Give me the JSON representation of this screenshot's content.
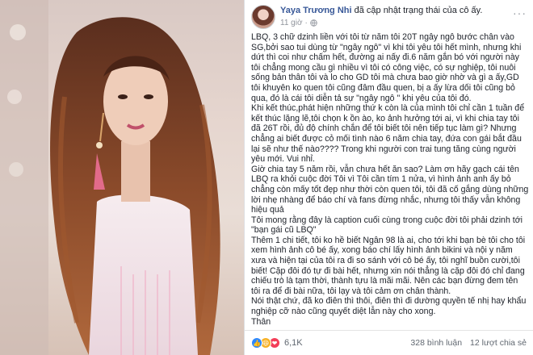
{
  "post": {
    "author": "Yaya Trương Nhi",
    "action": "đã cập nhật trạng thái của cô ấy.",
    "time": "11 giờ",
    "paragraphs": [
      "LBQ, 3 chữ dzinh liền với tôi từ năm tôi 20T ngây ngô bước chân vào SG,bởi sao tui dùng từ \"ngây ngô\" vì khi tôi yêu tôi hết mình, nhưng khi dứt thì coi như chấm hết, đường ai nấy đi.6 năm gắn bó với người này tôi chẳng mong cầu gì nhiều vì tôi có công việc, có sự nghiệp, tôi nuôi sống bản thân tôi và lo cho GD tôi mà chưa bao giờ nhờ và gì a ấy,GD tôi khuyên ko quen tôi cũng đâm đầu quen, bị a ấy lừa dối tôi cũng bỏ qua, đó là cái tôi diễn tả sự \"ngây ngô \" khi yêu của tôi đó.",
      "Khi kết thúc,phát hiện những thứ k còn là của mình tôi chỉ cần 1 tuần để kết thúc lặng lẽ,tôi chọn k ồn ào, ko ảnh hưởng tới ai, vì khi chia tay tôi đã 26T rồi, đủ độ chính chắn để tôi biết tôi nên tiếp tục làm gì? Nhưng chẳng ai biết được cỏ mối tình nào 6 năm chia tay, đứa con gái bắt đầu lại sẽ như thế nào???? Trong khi người con trai tung tăng cùng người yêu mới. Vui nhỉ.",
      "Giờ chia tay 5 năm rồi, vẫn chưa hết ăn sao? Làm ơn hãy gạch cái tên LBQ ra khỏi cuộc đời Tôi vì Tôi cần tím 1 nửa, vì hình ảnh anh ấy bỏ chẳng còn mấy tốt đẹp như thời còn quen tôi, tôi đã cố gắng dùng những lời nhẹ nhàng để báo chí và fans đừng nhắc, nhưng tôi thấy vẫn không hiệu quả",
      "Tôi mong rằng đây là caption cuối cùng trong cuộc đời tôi phải dzinh tới \"bạn gái cũ LBQ\"",
      "Thêm 1 chi tiết, tôi ko hề biết Ngân 98 là ai, cho tới khi bạn bè tôi cho tôi xem hình ảnh cô bé ấy, xong báo chí lấy hình ảnh bikini và nội y năm xưa và hiện tại của tôi ra đi so sánh với cô bé ấy, tôi nghĩ buồn cười,tôi biết! Cặp đôi đó tự đi bài hết, nhưng xin nói thẳng là cặp đôi đó chỉ đang chiếu trò là tạm thời, thành tựu là mãi mãi. Nên các bạn đừng đem tên tôi ra để đi bài nữa, tôi lạy và tôi cảm ơn chân thành.",
      "Nói thật chứ, đã ko điên thì thôi, điên thì đi dường quyền tế nhị hay khẩu nghiệp cỡ nào cũng quyết diệt lẫn này cho xong.",
      "Thân"
    ]
  },
  "footer": {
    "reaction_count": "6,1K",
    "comments": "328 bình luận",
    "shares": "12 lượt chia sẻ"
  },
  "colors": {
    "author_link": "#385898",
    "like": "#2d88ff",
    "haha": "#f7b125",
    "love": "#f33e58"
  },
  "icons": [
    "globe-icon",
    "more-icon",
    "like-icon",
    "haha-icon",
    "love-icon"
  ]
}
